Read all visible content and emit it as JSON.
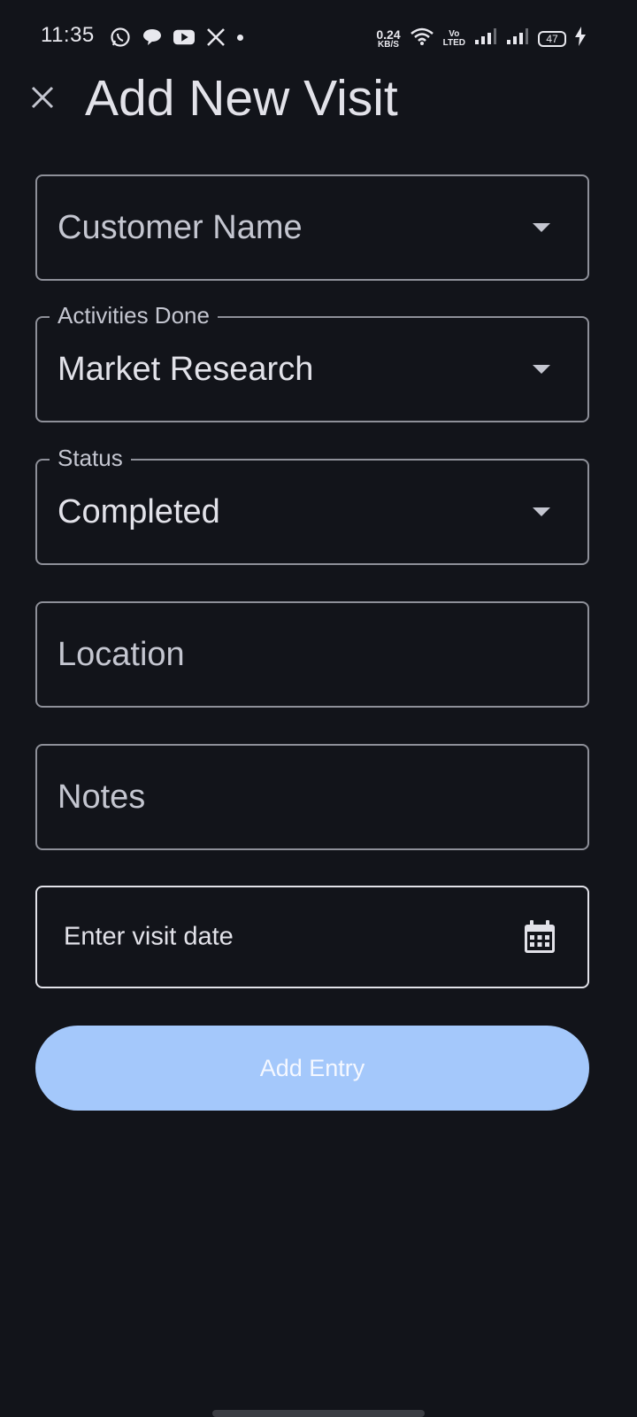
{
  "status_bar": {
    "time": "11:35",
    "net_speed_value": "0.24",
    "net_speed_unit": "KB/S",
    "volte_top": "Vo",
    "volte_bottom": "LTED",
    "battery": "47",
    "icons": [
      "whatsapp-icon",
      "chat-icon",
      "youtube-icon",
      "x-icon",
      "dot-icon",
      "wifi-icon",
      "signal-icon",
      "signal-icon-2",
      "charging-icon"
    ]
  },
  "app_bar": {
    "title": "Add New Visit",
    "close_icon": "close-icon"
  },
  "form": {
    "customer_name": {
      "placeholder": "Customer Name"
    },
    "activities_done": {
      "label": "Activities Done",
      "value": "Market Research"
    },
    "status": {
      "label": "Status",
      "value": "Completed"
    },
    "location": {
      "placeholder": "Location"
    },
    "notes": {
      "placeholder": "Notes"
    },
    "visit_date": {
      "placeholder": "Enter visit date",
      "icon": "calendar-icon"
    },
    "submit_label": "Add Entry"
  },
  "colors": {
    "background": "#12141a",
    "outline": "#8e9099",
    "button": "#a4c8fb"
  }
}
